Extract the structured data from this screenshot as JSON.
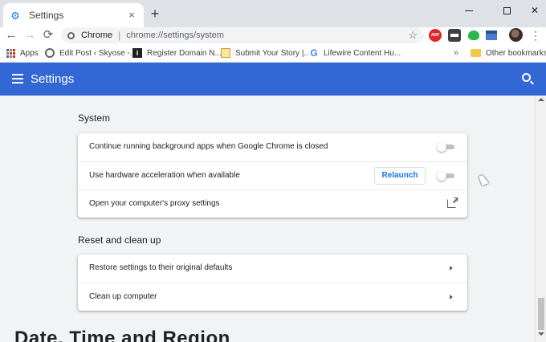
{
  "tab": {
    "title": "Settings",
    "favicon": "gear-icon",
    "close": "×"
  },
  "new_tab": "+",
  "window": {
    "minimize": "",
    "maximize": "",
    "close": "✕"
  },
  "nav": {
    "back": "←",
    "forward": "→",
    "reload": "⟳"
  },
  "omnibox": {
    "site_label": "Chrome",
    "separator": "|",
    "url": "chrome://settings/system",
    "star": "☆"
  },
  "extensions": [
    {
      "name": "ABP",
      "icon": "adblock-icon"
    },
    {
      "icon": "extension-icon"
    },
    {
      "icon": "evernote-icon"
    },
    {
      "icon": "calendar-icon"
    }
  ],
  "kebab": "⋮",
  "bookmarks": {
    "items": [
      {
        "label": "Apps",
        "icon": "apps-grid-icon"
      },
      {
        "label": "Edit Post ‹ Skyose -...",
        "icon": "globe-icon"
      },
      {
        "label": "Register Domain N...",
        "icon": "i-icon"
      },
      {
        "label": "Submit Your Story |...",
        "icon": "note-icon"
      },
      {
        "label": "Lifewire Content Hu...",
        "icon": "google-icon"
      }
    ],
    "more": "»",
    "other": "Other bookmarks"
  },
  "settings_header": {
    "title": "Settings"
  },
  "sections": {
    "system": {
      "title": "System",
      "rows": [
        {
          "label": "Continue running background apps when Google Chrome is closed",
          "toggle": false
        },
        {
          "label": "Use hardware acceleration when available",
          "toggle": false,
          "button": "Relaunch"
        },
        {
          "label": "Open your computer's proxy settings"
        }
      ]
    },
    "reset": {
      "title": "Reset and clean up",
      "rows": [
        {
          "label": "Restore settings to their original defaults"
        },
        {
          "label": "Clean up computer"
        }
      ]
    }
  },
  "cropped_text": "Date, Time and Region",
  "colors": {
    "accent": "#3367d6",
    "link": "#1a73e8",
    "background": "#f1f3f4"
  }
}
